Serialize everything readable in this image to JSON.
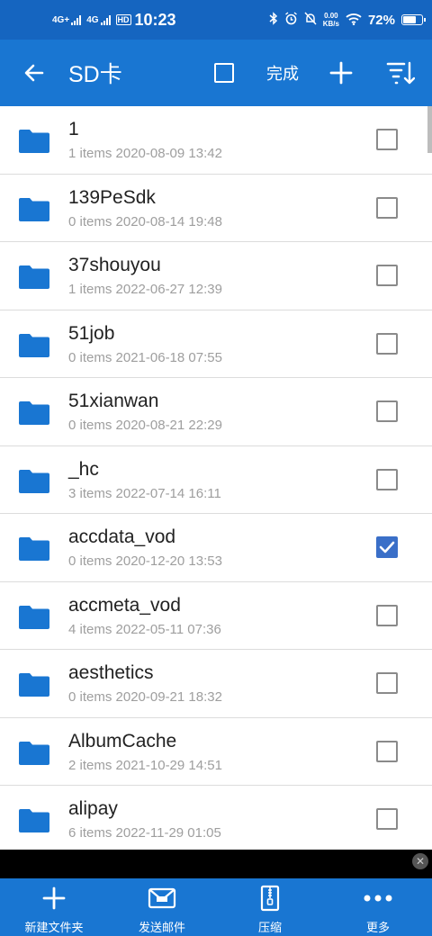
{
  "status_bar": {
    "network_1": "4G+",
    "network_2": "4G",
    "hd_badge": "HD",
    "time": "10:23",
    "speed_value": "0.00",
    "speed_unit": "KB/s",
    "battery_pct": "72%",
    "battery_level": 0.72
  },
  "app_bar": {
    "title": "SD卡",
    "done_label": "完成"
  },
  "items": [
    {
      "name": "1",
      "meta": "1 items 2020-08-09 13:42",
      "checked": false
    },
    {
      "name": "139PeSdk",
      "meta": "0 items 2020-08-14 19:48",
      "checked": false
    },
    {
      "name": "37shouyou",
      "meta": "1 items 2022-06-27 12:39",
      "checked": false
    },
    {
      "name": "51job",
      "meta": "0 items 2021-06-18 07:55",
      "checked": false
    },
    {
      "name": "51xianwan",
      "meta": "0 items 2020-08-21 22:29",
      "checked": false
    },
    {
      "name": "_hc",
      "meta": "3 items 2022-07-14 16:11",
      "checked": false
    },
    {
      "name": "accdata_vod",
      "meta": "0 items 2020-12-20 13:53",
      "checked": true
    },
    {
      "name": "accmeta_vod",
      "meta": "4 items 2022-05-11 07:36",
      "checked": false
    },
    {
      "name": "aesthetics",
      "meta": "0 items 2020-09-21 18:32",
      "checked": false
    },
    {
      "name": "AlbumCache",
      "meta": "2 items 2021-10-29 14:51",
      "checked": false
    },
    {
      "name": "alipay",
      "meta": "6 items 2022-11-29 01:05",
      "checked": false
    }
  ],
  "bottom_bar": [
    {
      "label": "新建文件夹",
      "icon": "plus-icon"
    },
    {
      "label": "发送邮件",
      "icon": "mail-icon"
    },
    {
      "label": "压缩",
      "icon": "zip-icon"
    },
    {
      "label": "更多",
      "icon": "more-icon"
    }
  ],
  "colors": {
    "app_bar": "#1976d2",
    "status_bar": "#1565c0",
    "folder": "#1976d2",
    "checked": "#3a6fc8"
  }
}
